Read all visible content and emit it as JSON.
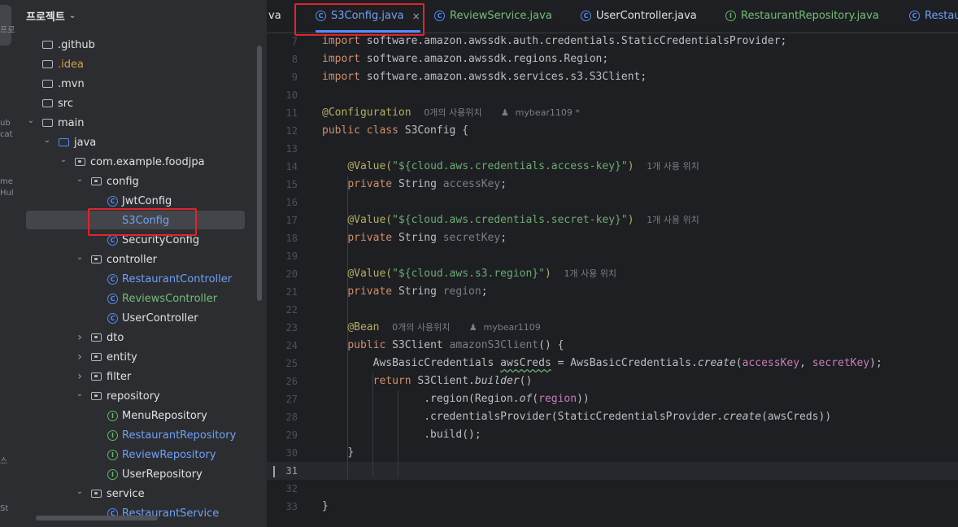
{
  "rail": {
    "fragments": [
      "프로",
      "ub",
      "cat",
      "me",
      "Hul",
      "스",
      "St"
    ]
  },
  "project": {
    "title": "프로젝트",
    "tree": [
      {
        "label": "github",
        "prefix": ".",
        "kind": "folder",
        "depth": 0,
        "arrow": "",
        "color": "def"
      },
      {
        "label": "idea",
        "prefix": ".",
        "kind": "folder",
        "depth": 0,
        "arrow": "",
        "color": "orange"
      },
      {
        "label": "mvn",
        "prefix": ".",
        "kind": "folder",
        "depth": 0,
        "arrow": "",
        "color": "def"
      },
      {
        "label": "src",
        "prefix": "",
        "kind": "folder",
        "depth": 0,
        "arrow": "",
        "color": "def"
      },
      {
        "label": "main",
        "prefix": "",
        "kind": "folder",
        "depth": 0,
        "arrow": "down",
        "color": "def"
      },
      {
        "label": "java",
        "prefix": "",
        "kind": "folder-blue",
        "depth": 1,
        "arrow": "down",
        "color": "def"
      },
      {
        "label": "com.example.foodjpa",
        "prefix": "",
        "kind": "package",
        "depth": 2,
        "arrow": "down",
        "color": "def"
      },
      {
        "label": "config",
        "prefix": "",
        "kind": "package",
        "depth": 3,
        "arrow": "down",
        "color": "def"
      },
      {
        "label": "JwtConfig",
        "prefix": "",
        "kind": "class",
        "depth": 4,
        "arrow": "",
        "color": "def"
      },
      {
        "label": "S3Config",
        "prefix": "",
        "kind": "class",
        "depth": 4,
        "arrow": "",
        "color": "blue",
        "selected": true
      },
      {
        "label": "SecurityConfig",
        "prefix": "",
        "kind": "class",
        "depth": 4,
        "arrow": "",
        "color": "def"
      },
      {
        "label": "controller",
        "prefix": "",
        "kind": "package",
        "depth": 3,
        "arrow": "down",
        "color": "def"
      },
      {
        "label": "RestaurantController",
        "prefix": "",
        "kind": "class",
        "depth": 4,
        "arrow": "",
        "color": "blue"
      },
      {
        "label": "ReviewsController",
        "prefix": "",
        "kind": "class",
        "depth": 4,
        "arrow": "",
        "color": "green"
      },
      {
        "label": "UserController",
        "prefix": "",
        "kind": "class",
        "depth": 4,
        "arrow": "",
        "color": "def"
      },
      {
        "label": "dto",
        "prefix": "",
        "kind": "package",
        "depth": 3,
        "arrow": "right",
        "color": "def"
      },
      {
        "label": "entity",
        "prefix": "",
        "kind": "package",
        "depth": 3,
        "arrow": "right",
        "color": "def"
      },
      {
        "label": "filter",
        "prefix": "",
        "kind": "package",
        "depth": 3,
        "arrow": "right",
        "color": "def"
      },
      {
        "label": "repository",
        "prefix": "",
        "kind": "package",
        "depth": 3,
        "arrow": "down",
        "color": "def"
      },
      {
        "label": "MenuRepository",
        "prefix": "",
        "kind": "interface",
        "depth": 4,
        "arrow": "",
        "color": "def"
      },
      {
        "label": "RestaurantRepository",
        "prefix": "",
        "kind": "interface",
        "depth": 4,
        "arrow": "",
        "color": "blue"
      },
      {
        "label": "ReviewRepository",
        "prefix": "",
        "kind": "interface",
        "depth": 4,
        "arrow": "",
        "color": "blue"
      },
      {
        "label": "UserRepository",
        "prefix": "",
        "kind": "interface",
        "depth": 4,
        "arrow": "",
        "color": "def"
      },
      {
        "label": "service",
        "prefix": "",
        "kind": "package",
        "depth": 3,
        "arrow": "down",
        "color": "def"
      },
      {
        "label": "RestaurantService",
        "prefix": "",
        "kind": "class",
        "depth": 4,
        "arrow": "",
        "color": "blue"
      }
    ]
  },
  "tabs": [
    {
      "label": "va",
      "icon": "none",
      "active": false,
      "color": "def"
    },
    {
      "label": "S3Config.java",
      "icon": "class",
      "active": true,
      "color": "blue",
      "close": "×"
    },
    {
      "label": "ReviewService.java",
      "icon": "class",
      "active": false,
      "color": "green"
    },
    {
      "label": "UserController.java",
      "icon": "class",
      "active": false,
      "color": "def"
    },
    {
      "label": "RestaurantRepository.java",
      "icon": "interface",
      "active": false,
      "color": "green"
    },
    {
      "label": "Restau",
      "icon": "class",
      "active": false,
      "color": "blue"
    }
  ],
  "editor": {
    "line_numbers": [
      "7",
      "8",
      "9",
      "10",
      "11",
      "12",
      "13",
      "14",
      "15",
      "16",
      "17",
      "18",
      "19",
      "20",
      "21",
      "22",
      "23",
      "24",
      "25",
      "26",
      "27",
      "28",
      "29",
      "30",
      "31",
      "32",
      "33"
    ],
    "current_line": "31",
    "code": {
      "l7": "import software.amazon.awssdk.auth.credentials.StaticCredentialsProvider;",
      "l8": "import software.amazon.awssdk.regions.Region;",
      "l9": "import software.amazon.awssdk.services.s3.S3Client;",
      "l11_ann": "@Configuration",
      "l11_hint1": "0개의 사용위치",
      "l11_hint2": "mybear1109 *",
      "l12_kw": "public class ",
      "l12_rest": "S3Config {",
      "l14_ann": "@Value(",
      "l14_str": "\"${cloud.aws.credentials.access-key}\"",
      "l14_close": ")",
      "l14_hint": "1개 사용 위치",
      "l15_kw": "private ",
      "l15_type": "String ",
      "l15_fld": "accessKey",
      "l15_end": ";",
      "l17_ann": "@Value(",
      "l17_str": "\"${cloud.aws.credentials.secret-key}\"",
      "l17_close": ")",
      "l17_hint": "1개 사용 위치",
      "l18_kw": "private ",
      "l18_type": "String ",
      "l18_fld": "secretKey",
      "l18_end": ";",
      "l20_ann": "@Value(",
      "l20_str": "\"${cloud.aws.s3.region}\"",
      "l20_close": ")",
      "l20_hint": "1개 사용 위치",
      "l21_kw": "private ",
      "l21_type": "String ",
      "l21_fld": "region",
      "l21_end": ";",
      "l23_ann": "@Bean",
      "l23_hint1": "0개의 사용위치",
      "l23_hint2": "mybear1109",
      "l24_kw": "public ",
      "l24_type": "S3Client ",
      "l24_name": "amazonS3Client",
      "l24_end": "() {",
      "l25_a": "AwsBasicCredentials ",
      "l25_var": "awsCreds",
      "l25_b": " = AwsBasicCredentials.",
      "l25_m": "create",
      "l25_c": "(",
      "l25_f1": "accessKey",
      "l25_d": ", ",
      "l25_f2": "secretKey",
      "l25_e": ");",
      "l26_kw": "return ",
      "l26_a": "S3Client.",
      "l26_m": "builder",
      "l26_b": "()",
      "l27_a": ".region(Region.",
      "l27_m": "of",
      "l27_b": "(",
      "l27_f": "region",
      "l27_c": "))",
      "l28_a": ".credentialsProvider(StaticCredentialsProvider.",
      "l28_m": "create",
      "l28_b": "(awsCreds))",
      "l29": ".build();",
      "l30": "}",
      "l33": "}"
    }
  },
  "colors": {
    "accent": "#548af7",
    "highlight_box": "#e0242b",
    "interface_icon": "#5fb865"
  }
}
